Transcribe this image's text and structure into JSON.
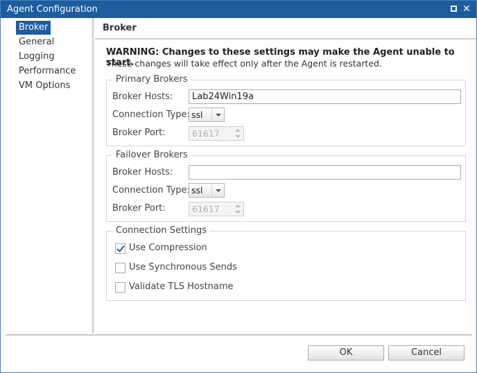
{
  "window": {
    "title": "Agent Configuration"
  },
  "nav": {
    "items": [
      {
        "label": "Broker",
        "active": true
      },
      {
        "label": "General",
        "active": false
      },
      {
        "label": "Logging",
        "active": false
      },
      {
        "label": "Performance",
        "active": false
      },
      {
        "label": "VM Options",
        "active": false
      }
    ]
  },
  "main": {
    "heading": "Broker",
    "warning": "WARNING: Changes to these settings may make the Agent unable to start.",
    "warning_sub": "These changes will take effect only after the Agent is restarted."
  },
  "primary": {
    "legend": "Primary Brokers",
    "hosts_label": "Broker Hosts:",
    "hosts_value": "Lab24Win19a",
    "conn_type_label": "Connection Type:",
    "conn_type_value": "ssl",
    "port_label": "Broker Port:",
    "port_value": "61617"
  },
  "failover": {
    "legend": "Failover Brokers",
    "hosts_label": "Broker Hosts:",
    "hosts_value": "",
    "conn_type_label": "Connection Type:",
    "conn_type_value": "ssl",
    "port_label": "Broker Port:",
    "port_value": "61617"
  },
  "connection_settings": {
    "legend": "Connection Settings",
    "options": [
      {
        "label": "Use Compression",
        "checked": true
      },
      {
        "label": "Use Synchronous Sends",
        "checked": false
      },
      {
        "label": "Validate TLS Hostname",
        "checked": false
      }
    ]
  },
  "footer": {
    "ok_label": "OK",
    "cancel_label": "Cancel"
  },
  "colors": {
    "accent": "#1d5c9e"
  }
}
